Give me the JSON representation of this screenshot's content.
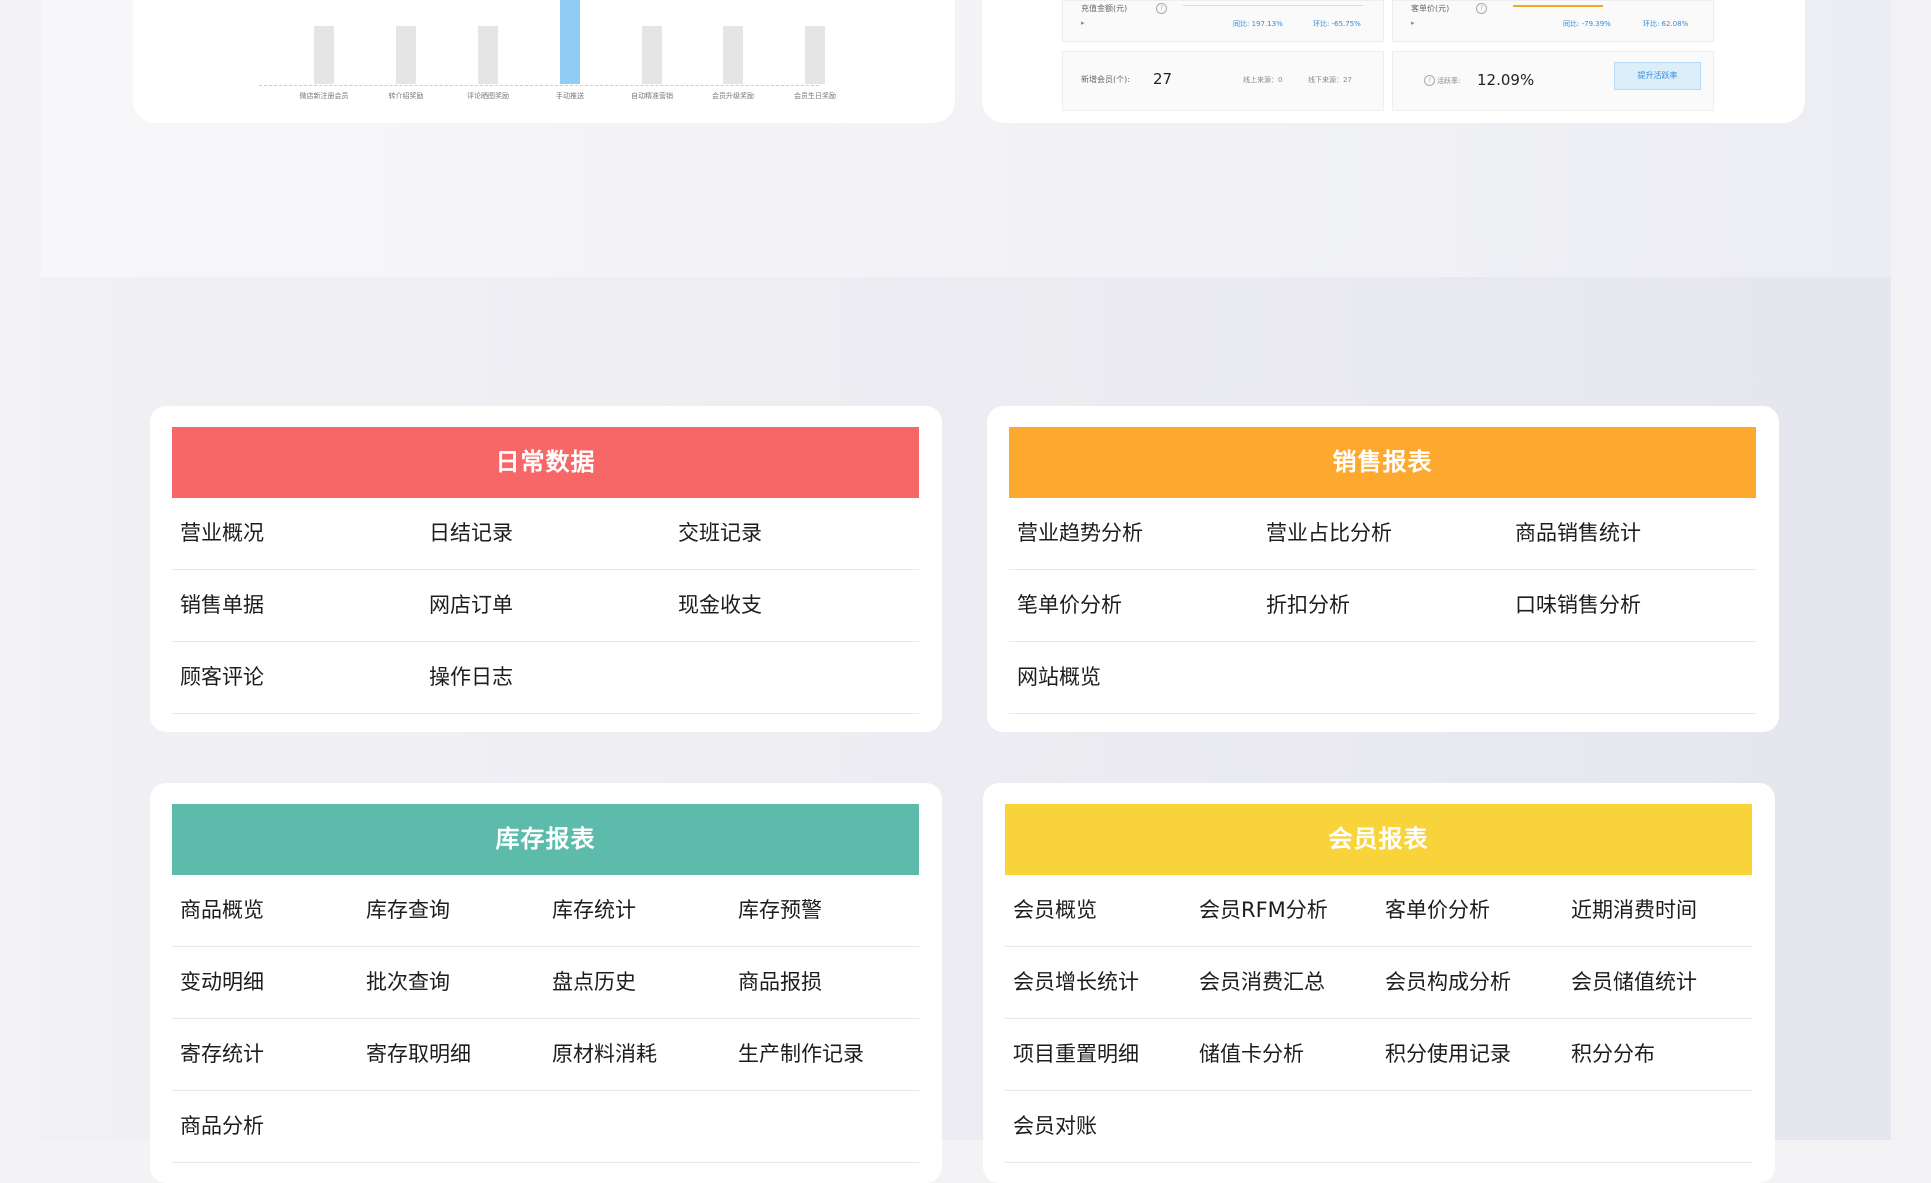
{
  "top_chart": {
    "categories": [
      "微店新注册会员",
      "转介绍奖励",
      "评论晒图奖励",
      "手动推送",
      "自动精准营销",
      "会员升级奖励",
      "会员生日奖励"
    ]
  },
  "top_stats": {
    "recharge_label": "充值金额(元)",
    "recharge_yoy": "同比:  197.13%",
    "recharge_mom": "环比:  -65.75%",
    "avg_label": "客单价(元)",
    "avg_yoy": "同比:  -79.39%",
    "avg_mom": "环比:  62.08%",
    "new_members_label": "新增会员(个):",
    "new_members_value": "27",
    "online_source": "线上来源：0",
    "offline_source": "线下来源：27",
    "active_label": "活跃率:",
    "active_value": "12.09%",
    "boost_button": "提升活跃率"
  },
  "colors": {
    "daily": "#f86767",
    "sales": "#fda92f",
    "inventory": "#5dbbac",
    "member": "#f8d33a"
  },
  "cards": {
    "daily": {
      "title": "日常数据",
      "rows": [
        [
          "营业概况",
          "日结记录",
          "交班记录"
        ],
        [
          "销售单据",
          "网店订单",
          "现金收支"
        ],
        [
          "顾客评论",
          "操作日志"
        ]
      ]
    },
    "sales": {
      "title": "销售报表",
      "rows": [
        [
          "营业趋势分析",
          "营业占比分析",
          "商品销售统计"
        ],
        [
          "笔单价分析",
          "折扣分析",
          "口味销售分析"
        ],
        [
          "网站概览"
        ]
      ]
    },
    "inventory": {
      "title": "库存报表",
      "rows": [
        [
          "商品概览",
          "库存查询",
          "库存统计",
          "库存预警"
        ],
        [
          "变动明细",
          "批次查询",
          "盘点历史",
          "商品报损"
        ],
        [
          "寄存统计",
          "寄存取明细",
          "原材料消耗",
          "生产制作记录"
        ],
        [
          "商品分析"
        ]
      ]
    },
    "member": {
      "title": "会员报表",
      "rows": [
        [
          "会员概览",
          "会员RFM分析",
          "客单价分析",
          "近期消费时间"
        ],
        [
          "会员增长统计",
          "会员消费汇总",
          "会员构成分析",
          "会员储值统计"
        ],
        [
          "项目重置明细",
          "储值卡分析",
          "积分使用记录",
          "积分分布"
        ],
        [
          "会员对账"
        ]
      ]
    }
  }
}
